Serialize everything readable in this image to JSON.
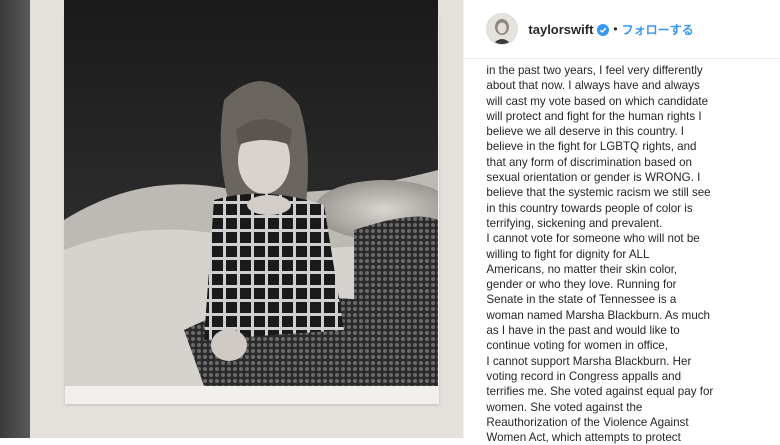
{
  "post": {
    "username": "taylorswift",
    "separator": "•",
    "follow_label": "フォローする",
    "caption_lines": [
      "in the past two years, I feel very differently",
      "about that now. I always have and always",
      "will cast my vote based on which candidate",
      "will protect and fight for the human rights I",
      "believe we all deserve in this country. I",
      "believe in the fight for LGBTQ rights, and",
      "that any form of discrimination based on",
      "sexual orientation or gender is WRONG. I",
      "believe that the systemic racism we still see",
      "in this country towards people of color is",
      "terrifying, sickening and prevalent.",
      "I cannot vote for someone who will not be",
      "willing to fight for dignity for ALL",
      "Americans, no matter their skin color,",
      "gender or who they love. Running for",
      "Senate in the state of Tennessee is a",
      "woman named Marsha Blackburn. As much",
      "as I have in the past and would like to",
      "continue voting for women in office,",
      "I cannot support Marsha Blackburn. Her",
      "voting record in Congress appalls and",
      "terrifies me. She voted against equal pay for",
      "women. She voted against the",
      "Reauthorization of the Violence Against",
      "Women Act, which attempts to protect"
    ]
  },
  "icons": {
    "verified": "verified-badge-icon",
    "avatar": "profile-avatar"
  },
  "colors": {
    "link": "#3897f0",
    "text": "#262626",
    "verified": "#3897f0"
  }
}
